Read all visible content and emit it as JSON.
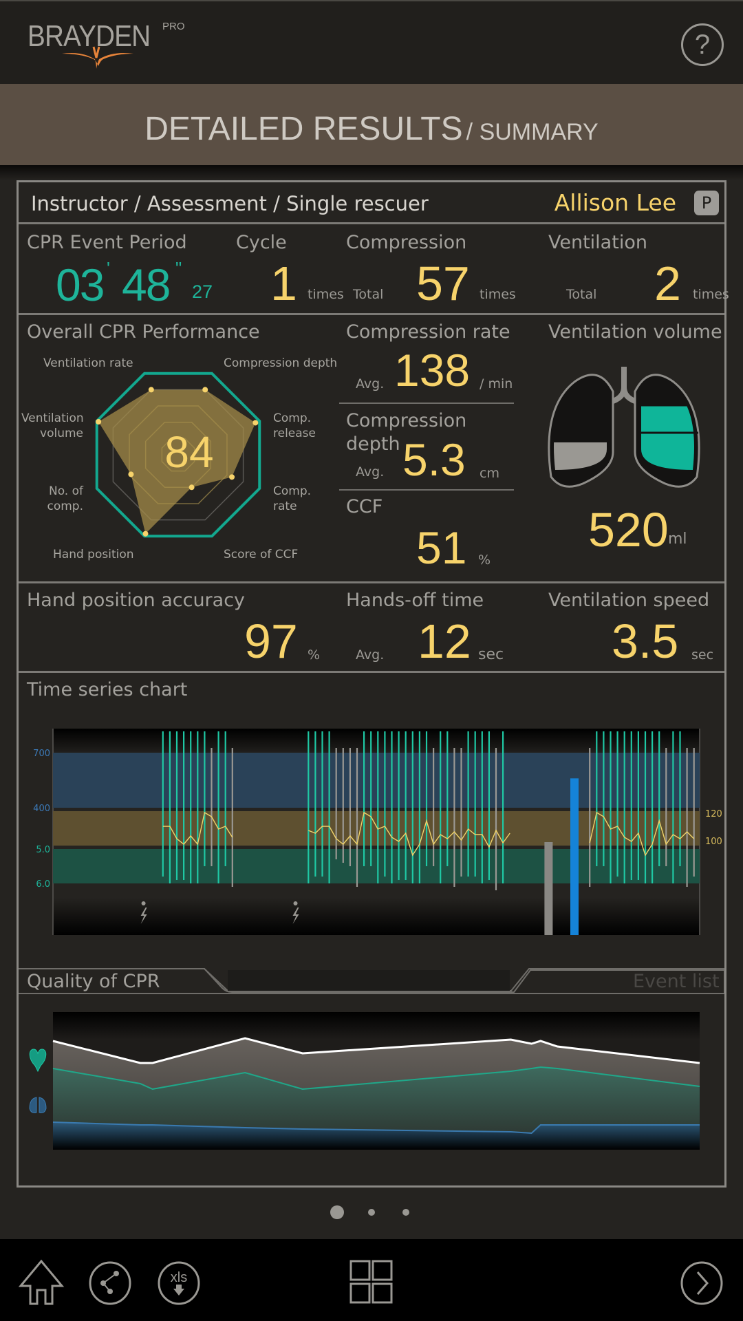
{
  "app": {
    "logo_text": "BRAYDEN",
    "logo_badge": "PRO",
    "help_label": "?"
  },
  "title": {
    "main": "DETAILED RESULTS",
    "sub": "/ SUMMARY"
  },
  "session": {
    "breadcrumb": "Instructor / Assessment / Single rescuer",
    "user_name": "Allison Lee",
    "user_badge": "P"
  },
  "summary": {
    "event_period": {
      "label": "CPR Event Period",
      "minutes": "03",
      "seconds": "48",
      "hundredths": "27",
      "min_mark": "'",
      "sec_mark": "\""
    },
    "cycle": {
      "label": "Cycle",
      "value": "1",
      "unit": "times"
    },
    "compression": {
      "label": "Compression",
      "prefix": "Total",
      "value": "57",
      "unit": "times"
    },
    "ventilation": {
      "label": "Ventilation",
      "prefix": "Total",
      "value": "2",
      "unit": "times"
    }
  },
  "performance": {
    "title": "Overall CPR Performance",
    "score": "84",
    "axes": [
      {
        "label": "Compression depth",
        "value": 0.8
      },
      {
        "label": "Comp. release",
        "value": 0.95
      },
      {
        "label": "Comp. rate",
        "value": 0.66
      },
      {
        "label": "Score of CCF",
        "value": 0.4
      },
      {
        "label": "Hand position",
        "value": 0.97
      },
      {
        "label": "No. of comp.",
        "value": 0.58
      },
      {
        "label": "Ventilation volume",
        "value": 0.98
      },
      {
        "label": "Ventilation rate",
        "value": 0.8
      }
    ],
    "axis_labels": {
      "ventilation_rate": "Ventilation rate",
      "compression_depth": "Compression depth",
      "ventilation_volume_1": "Ventilation",
      "ventilation_volume_2": "volume",
      "comp_release_1": "Comp.",
      "comp_release_2": "release",
      "no_comp_1": "No. of",
      "no_comp_2": "comp.",
      "comp_rate_1": "Comp.",
      "comp_rate_2": "rate",
      "hand_position": "Hand position",
      "score_ccf": "Score of CCF"
    }
  },
  "compression_rate": {
    "label": "Compression rate",
    "prefix": "Avg.",
    "value": "138",
    "unit": "/ min"
  },
  "compression_depth": {
    "label_1": "Compression",
    "label_2": "depth",
    "prefix": "Avg.",
    "value": "5.3",
    "unit": "cm"
  },
  "ccf": {
    "label": "CCF",
    "value": "51",
    "unit": "%"
  },
  "ventilation_volume": {
    "label": "Ventilation volume",
    "value": "520",
    "unit": "ml",
    "left_fill": 0.4,
    "right_fill": 0.75
  },
  "hand_position": {
    "label": "Hand position accuracy",
    "value": "97",
    "unit": "%"
  },
  "hands_off": {
    "label": "Hands-off time",
    "prefix": "Avg.",
    "value": "12",
    "unit": "sec"
  },
  "ventilation_speed": {
    "label": "Ventilation speed",
    "value": "3.5",
    "unit": "sec"
  },
  "time_series": {
    "title": "Time series chart",
    "left_ticks": [
      {
        "label": "700",
        "color": "#3c7ab8"
      },
      {
        "label": "400",
        "color": "#3c7ab8"
      },
      {
        "label": "5.0",
        "color": "#1eb49a"
      },
      {
        "label": "6.0",
        "color": "#1eb49a"
      }
    ],
    "right_ticks": [
      "120",
      "100"
    ],
    "colors": {
      "ventilation_band": "#2a4258",
      "rate_band": "#5e5030",
      "depth_band": "#1d5244",
      "compression": "#1fc8a4",
      "recoil_bad": "#9a9893",
      "rate_line": "#f0d36a",
      "ventilation_bar": "#1583d8",
      "pause_bar": "#8a8884"
    }
  },
  "quality": {
    "tab_active": "Quality of CPR",
    "tab_inactive": "Event list"
  },
  "pager": {
    "count": 3,
    "active": 0
  },
  "bottom_nav": {
    "home": "home",
    "share": "share",
    "xls": "xls",
    "grid": "grid",
    "next": "next"
  },
  "chart_data": [
    {
      "type": "radar",
      "title": "Overall CPR Performance",
      "center_label": "84",
      "categories": [
        "Compression depth",
        "Comp. release",
        "Comp. rate",
        "Score of CCF",
        "Hand position",
        "No. of comp.",
        "Ventilation volume",
        "Ventilation rate"
      ],
      "values": [
        0.8,
        0.95,
        0.66,
        0.4,
        0.97,
        0.58,
        0.98,
        0.8
      ],
      "range": [
        0,
        1
      ]
    },
    {
      "type": "line",
      "title": "Time series chart",
      "segments": [
        {
          "start": 0.17,
          "compressions": [
            {
              "depth": 5.8,
              "ok": true
            },
            {
              "depth": 6.0,
              "ok": true
            },
            {
              "depth": 5.9,
              "ok": true
            },
            {
              "depth": 5.9,
              "ok": true
            },
            {
              "depth": 6.0,
              "ok": true
            },
            {
              "depth": 6.0,
              "ok": true
            },
            {
              "depth": 5.5,
              "ok": true
            },
            {
              "depth": 5.5,
              "ok": false
            },
            {
              "depth": 6.0,
              "ok": true
            },
            {
              "depth": 5.5,
              "ok": true
            },
            {
              "depth": 6.1,
              "ok": false
            }
          ],
          "rates": [
            113,
            113,
            104,
            100,
            106,
            100,
            123,
            120,
            111,
            113,
            105
          ]
        },
        {
          "start": 0.395,
          "compressions": [
            {
              "depth": 6.0,
              "ok": true
            },
            {
              "depth": 5.8,
              "ok": true
            },
            {
              "depth": 5.8,
              "ok": true
            },
            {
              "depth": 6.0,
              "ok": true
            },
            {
              "depth": 5.3,
              "ok": false
            },
            {
              "depth": 5.4,
              "ok": false
            },
            {
              "depth": 5.5,
              "ok": false
            },
            {
              "depth": 6.1,
              "ok": false
            },
            {
              "depth": 5.5,
              "ok": true
            },
            {
              "depth": 5.5,
              "ok": true
            },
            {
              "depth": 6.0,
              "ok": true
            },
            {
              "depth": 5.8,
              "ok": true
            },
            {
              "depth": 6.0,
              "ok": true
            },
            {
              "depth": 5.9,
              "ok": true
            },
            {
              "depth": 5.9,
              "ok": true
            },
            {
              "depth": 6.0,
              "ok": true
            },
            {
              "depth": 6.0,
              "ok": true
            },
            {
              "depth": 5.5,
              "ok": true
            },
            {
              "depth": 5.5,
              "ok": false
            },
            {
              "depth": 6.0,
              "ok": true
            },
            {
              "depth": 5.5,
              "ok": true
            },
            {
              "depth": 6.1,
              "ok": false
            },
            {
              "depth": 5.8,
              "ok": false
            },
            {
              "depth": 5.8,
              "ok": true
            },
            {
              "depth": 5.8,
              "ok": true
            },
            {
              "depth": 6.0,
              "ok": true
            },
            {
              "depth": 5.9,
              "ok": true
            },
            {
              "depth": 6.2,
              "ok": false
            },
            {
              "depth": 6.0,
              "ok": true
            }
          ],
          "rates": [
            110,
            108,
            113,
            113,
            104,
            100,
            106,
            100,
            123,
            120,
            111,
            113,
            105,
            102,
            108,
            92,
            100,
            117,
            100,
            107,
            104,
            109,
            103,
            111,
            107,
            107,
            98,
            110,
            101,
            108
          ]
        },
        {
          "start": 0.83,
          "compressions": [
            {
              "depth": 6.1,
              "ok": false
            },
            {
              "depth": 5.5,
              "ok": true
            },
            {
              "depth": 5.5,
              "ok": true
            },
            {
              "depth": 6.0,
              "ok": true
            },
            {
              "depth": 5.8,
              "ok": true
            },
            {
              "depth": 6.0,
              "ok": true
            },
            {
              "depth": 5.9,
              "ok": true
            },
            {
              "depth": 5.9,
              "ok": true
            },
            {
              "depth": 6.0,
              "ok": true
            },
            {
              "depth": 6.0,
              "ok": true
            },
            {
              "depth": 5.5,
              "ok": true
            },
            {
              "depth": 5.5,
              "ok": false
            },
            {
              "depth": 6.0,
              "ok": true
            },
            {
              "depth": 5.5,
              "ok": true
            },
            {
              "depth": 6.1,
              "ok": false
            },
            {
              "depth": 5.8,
              "ok": false
            }
          ],
          "rates": [
            101,
            123,
            120,
            111,
            113,
            105,
            102,
            108,
            92,
            100,
            117,
            100,
            107,
            104,
            109,
            104
          ]
        }
      ],
      "pause_bar": {
        "x": 0.76,
        "height": 0.45
      },
      "ventilation_bar": {
        "x": 0.8,
        "volume": 560
      },
      "shock_markers": [
        0.14,
        0.375
      ],
      "left_axis_ticks": [
        "700",
        "400",
        "5.0",
        "6.0"
      ],
      "right_axis_ticks": [
        "120",
        "100"
      ]
    },
    {
      "type": "area",
      "title": "Quality of CPR",
      "x": [
        0,
        0.135,
        0.154,
        0.297,
        0.386,
        0.708,
        0.74,
        0.754,
        0.78,
        1.0
      ],
      "series": [
        {
          "name": "overall",
          "values": [
            0.79,
            0.63,
            0.63,
            0.81,
            0.7,
            0.8,
            0.77,
            0.79,
            0.75,
            0.63
          ]
        },
        {
          "name": "compression",
          "values": [
            0.59,
            0.48,
            0.44,
            0.56,
            0.44,
            0.57,
            0.59,
            0.6,
            0.59,
            0.46
          ]
        },
        {
          "name": "ventilation",
          "values": [
            0.2,
            0.18,
            0.18,
            0.16,
            0.15,
            0.13,
            0.12,
            0.18,
            0.18,
            0.18
          ]
        }
      ],
      "range": [
        0,
        1
      ]
    }
  ]
}
